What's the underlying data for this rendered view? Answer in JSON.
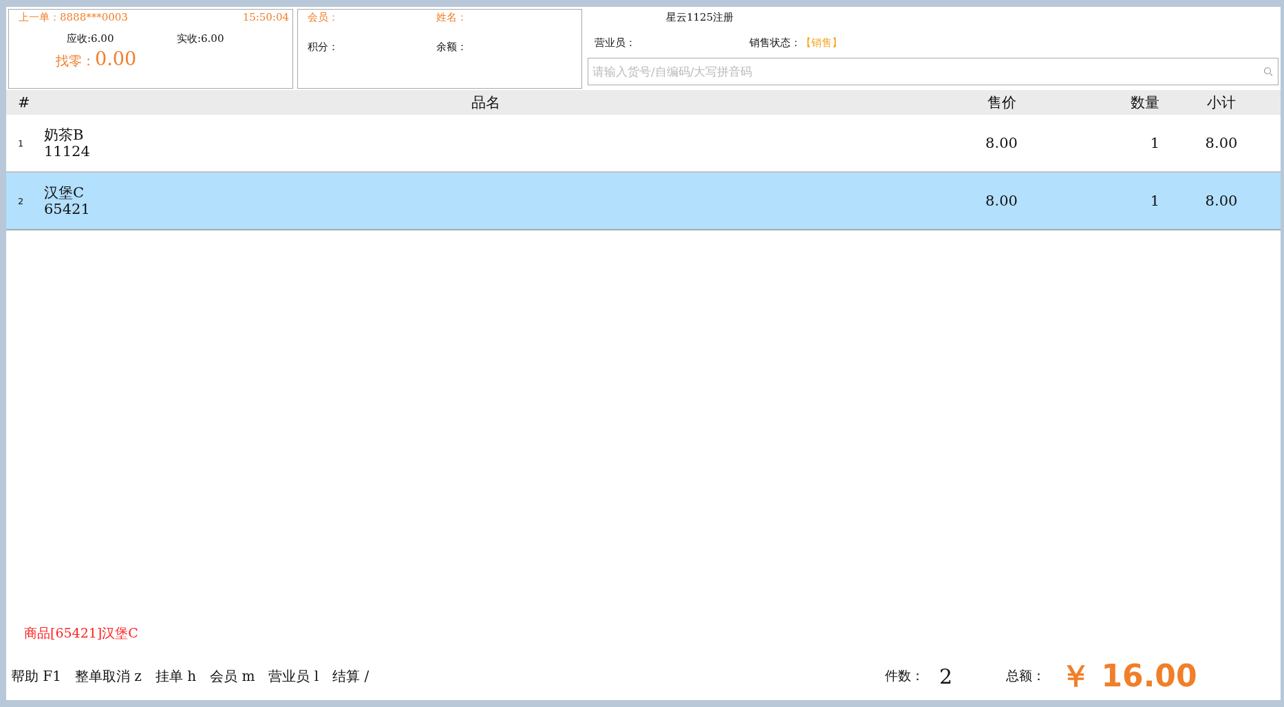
{
  "last_order": {
    "label": "上一单：8888***0003",
    "time": "15:50:04",
    "receivable": "应收:6.00",
    "received": "实收:6.00",
    "change_label": "找零：",
    "change_value": "0.00"
  },
  "member": {
    "member_label": "会员：",
    "name_label": "姓名：",
    "points_label": "积分：",
    "balance_label": "余额："
  },
  "register": {
    "title": "星云1125注册",
    "clerk_label": "营业员：",
    "status_label": "销售状态：",
    "status_value": "【销售】"
  },
  "search": {
    "placeholder": "请输入货号/自编码/大写拼音码"
  },
  "table": {
    "columns": [
      "#",
      "品名",
      "售价",
      "数量",
      "小计"
    ],
    "rows": [
      {
        "index": "1",
        "name": "奶茶B",
        "code": "11124",
        "price": "8.00",
        "qty": "1",
        "subtotal": "8.00",
        "selected": false
      },
      {
        "index": "2",
        "name": "汉堡C",
        "code": "65421",
        "price": "8.00",
        "qty": "1",
        "subtotal": "8.00",
        "selected": true
      }
    ]
  },
  "message": "商品[65421]汉堡C",
  "shortcuts": [
    "帮助 F1",
    "整单取消 z",
    "挂单 h",
    "会员 m",
    "营业员 l",
    "结算 /"
  ],
  "totals": {
    "count_label": "件数：",
    "count": "2",
    "amount_label": "总额：",
    "amount": "￥ 16.00"
  }
}
